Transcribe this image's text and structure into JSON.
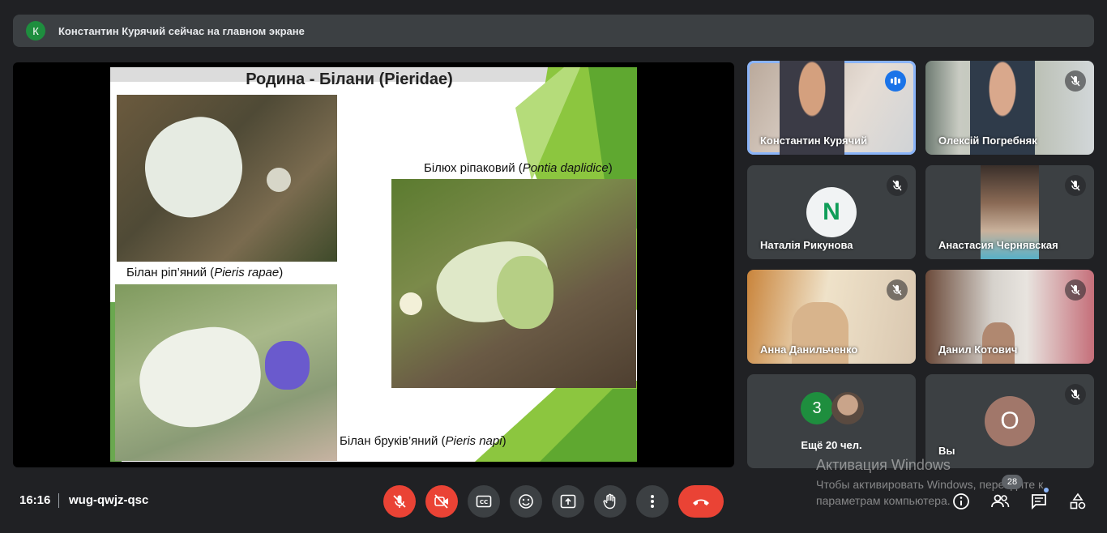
{
  "banner": {
    "avatar_letter": "К",
    "text": "Константин Курячий сейчас на главном экране"
  },
  "slide": {
    "title": "Родина -  Білани (Pieridae)",
    "captions": [
      {
        "text": "Білан ріп’яний (",
        "latin": "Pieris rapae",
        "end": ")"
      },
      {
        "text": "Білюх ріпаковий (",
        "latin": "Pontia daplidice",
        "end": ")"
      },
      {
        "text": "Білан бруків’яний (",
        "latin": "Pieris napi",
        "end": ")"
      }
    ]
  },
  "participants": [
    {
      "name": "Константин Курячий",
      "state": "speaking"
    },
    {
      "name": "Олексій Погребняк",
      "state": "muted"
    },
    {
      "name": "Наталія Рикунова",
      "state": "muted",
      "avatar_letter": "N"
    },
    {
      "name": "Анастасия Чернявская",
      "state": "muted"
    },
    {
      "name": "Анна Данильченко",
      "state": "muted"
    },
    {
      "name": "Данил Котович",
      "state": "muted"
    },
    {
      "name": "Ещё 20 чел.",
      "count": "3"
    },
    {
      "name": "Вы",
      "state": "muted",
      "avatar_letter": "О"
    }
  ],
  "watermark": {
    "line1": "Активация Windows",
    "line2": "Чтобы активировать Windows, перейдите к параметрам компьютера."
  },
  "bottom": {
    "time": "16:16",
    "meeting_code": "wug-qwjz-qsc",
    "participants_badge": "28"
  },
  "colors": {
    "background": "#202124",
    "tile": "#3c4043",
    "accent_blue": "#8ab4f8",
    "speaking_blue": "#1a73e8",
    "danger_red": "#ea4335",
    "green": "#1e8e3e"
  }
}
